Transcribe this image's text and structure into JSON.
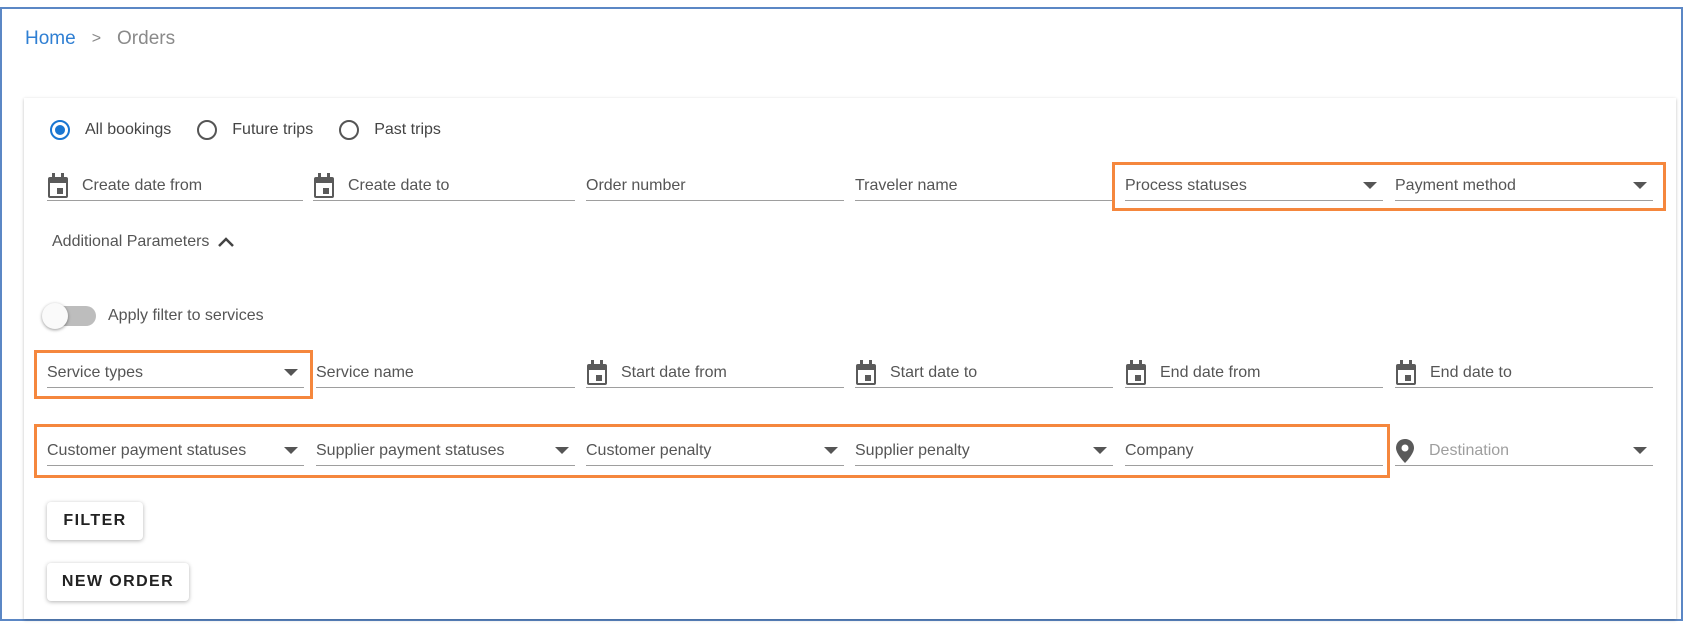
{
  "breadcrumb": {
    "home": "Home",
    "separator": ">",
    "current": "Orders"
  },
  "trip_filter": {
    "options": [
      "All bookings",
      "Future trips",
      "Past trips"
    ],
    "selected": "All bookings"
  },
  "row1": {
    "create_date_from": "Create date from",
    "create_date_to": "Create date to",
    "order_number": "Order number",
    "traveler_name": "Traveler name",
    "process_statuses": "Process statuses",
    "payment_method": "Payment method"
  },
  "additional_parameters": {
    "label": "Additional Parameters",
    "expanded": true
  },
  "apply_filter_toggle": {
    "label": "Apply filter to services",
    "on": false
  },
  "row2": {
    "service_types": "Service types",
    "service_name": "Service name",
    "start_date_from": "Start date from",
    "start_date_to": "Start date to",
    "end_date_from": "End date from",
    "end_date_to": "End date to"
  },
  "row3": {
    "customer_payment_statuses": "Customer payment statuses",
    "supplier_payment_statuses": "Supplier payment statuses",
    "customer_penalty": "Customer penalty",
    "supplier_penalty": "Supplier penalty",
    "company": "Company",
    "destination": "Destination"
  },
  "buttons": {
    "filter": "FILTER",
    "new_order": "NEW ORDER"
  },
  "icons": {
    "calendar": "calendar-icon",
    "dropdown": "dropdown-arrow-icon",
    "pin": "location-pin-icon",
    "chevron": "chevron-up-icon"
  },
  "colors": {
    "accent": "#1976d2",
    "link": "#2f7fd3",
    "highlight": "#f5873d",
    "frame": "#5b87c5"
  }
}
